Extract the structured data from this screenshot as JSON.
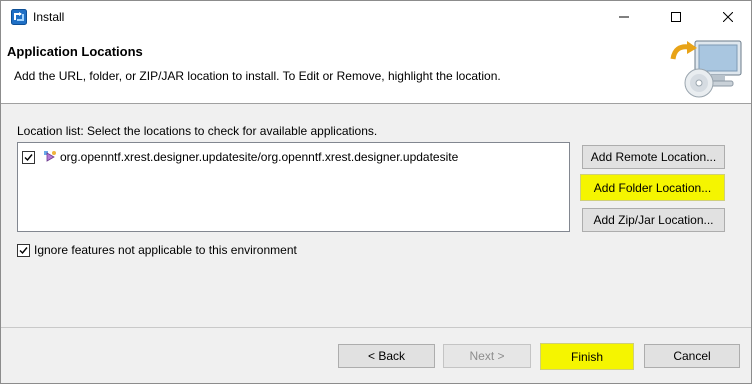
{
  "window": {
    "title": "Install",
    "controls": {
      "minimize": "minimize-icon",
      "maximize": "maximize-icon",
      "close": "close-icon"
    }
  },
  "banner": {
    "title": "Application Locations",
    "description": "Add the URL, folder, or ZIP/JAR location to install. To Edit or Remove, highlight the location."
  },
  "location_list": {
    "label": "Location list: Select the locations to check for available applications.",
    "items": [
      {
        "checked": true,
        "icon": "update-site-icon",
        "text": "org.openntf.xrest.designer.updatesite/org.openntf.xrest.designer.updatesite"
      }
    ]
  },
  "side_buttons": {
    "add_remote": "Add Remote Location...",
    "add_folder": "Add Folder Location...",
    "add_zip": "Add Zip/Jar Location..."
  },
  "ignore_option": {
    "checked": true,
    "label": "Ignore features not applicable to this environment"
  },
  "footer": {
    "back": "< Back",
    "next": "Next >",
    "finish": "Finish",
    "cancel": "Cancel"
  },
  "colors": {
    "highlight": "#f5f500",
    "button_face": "#e1e1e1",
    "dialog_bg": "#f0f0f0"
  }
}
